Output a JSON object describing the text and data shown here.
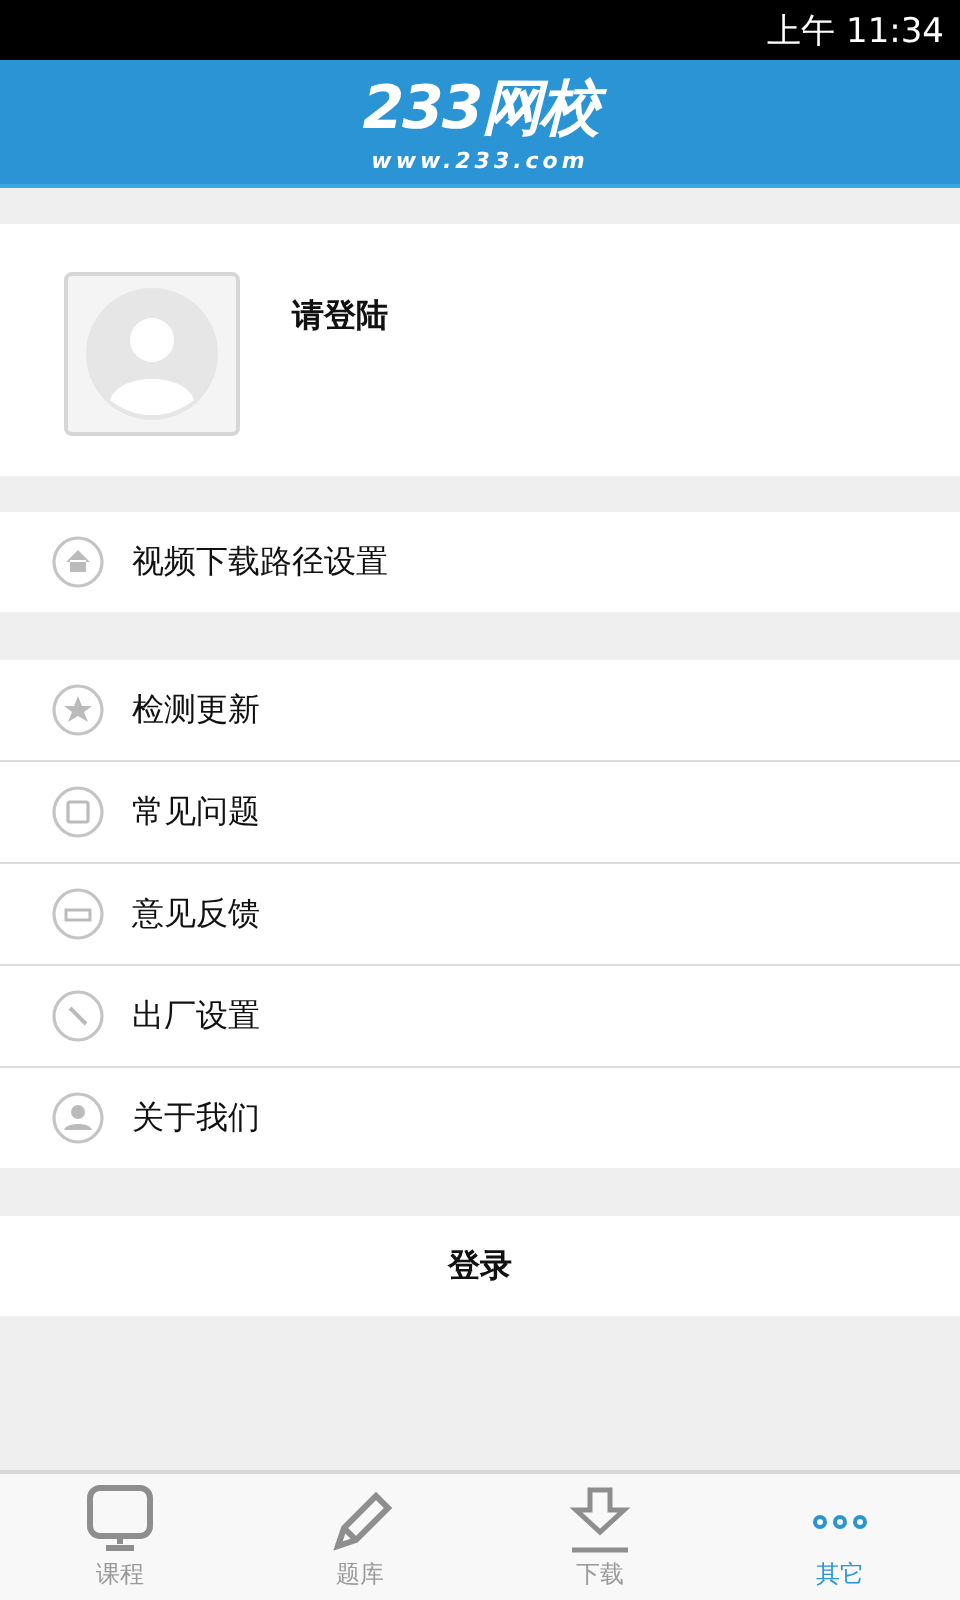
{
  "status_bar": {
    "time": "上午 11:34"
  },
  "header": {
    "logo": "233网校",
    "logo_url": "www.233.com"
  },
  "profile": {
    "name": "请登陆"
  },
  "menu_groups": [
    [
      {
        "label": "视频下载路径设置"
      }
    ],
    [
      {
        "label": "检测更新"
      },
      {
        "label": "常见问题"
      },
      {
        "label": "意见反馈"
      },
      {
        "label": "出厂设置"
      },
      {
        "label": "关于我们"
      }
    ]
  ],
  "login_button": "登录",
  "tabs": [
    {
      "label": "课程",
      "selected": false
    },
    {
      "label": "题库",
      "selected": false
    },
    {
      "label": "下载",
      "selected": false
    },
    {
      "label": "其它",
      "selected": true
    }
  ]
}
